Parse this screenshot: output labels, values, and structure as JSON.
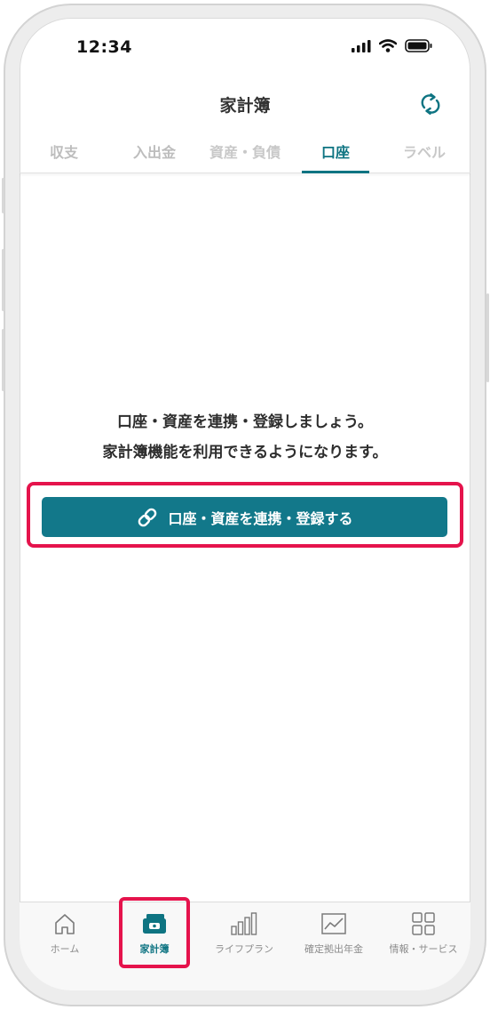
{
  "status_bar": {
    "time": "12:34"
  },
  "header": {
    "title": "家計簿",
    "sync_icon": "sync-icon"
  },
  "tabs": [
    {
      "label": "収支",
      "state": "partial"
    },
    {
      "label": "入出金",
      "state": "partial"
    },
    {
      "label": "資産・負債",
      "state": "dim"
    },
    {
      "label": "口座",
      "state": "active"
    },
    {
      "label": "ラベル",
      "state": "dim"
    }
  ],
  "empty_state": {
    "line1": "口座・資産を連携・登録しましょう。",
    "line2": "家計簿機能を利用できるようになります。"
  },
  "link_button": {
    "label": "口座・資産を連携・登録する",
    "icon": "link-icon"
  },
  "bottom_nav": [
    {
      "label": "ホーム",
      "icon": "home-icon"
    },
    {
      "label": "家計簿",
      "icon": "wallet-icon",
      "active": true
    },
    {
      "label": "ライフプラン",
      "icon": "bar-chart-icon"
    },
    {
      "label": "確定拠出年金",
      "icon": "line-chart-icon"
    },
    {
      "label": "情報・サービス",
      "icon": "grid-icon"
    }
  ],
  "colors": {
    "accent": "#0e7482",
    "highlight": "#e5134c",
    "button": "#12788a"
  }
}
